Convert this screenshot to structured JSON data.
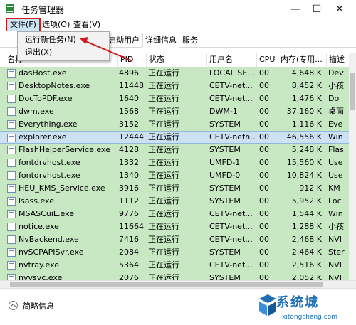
{
  "window": {
    "title": "任务管理器",
    "min": "—",
    "max": "☐",
    "close": "✕"
  },
  "menu": {
    "file": "文件(F)",
    "options": "选项(O)",
    "view": "查看(V)"
  },
  "file_menu": {
    "items": [
      "运行新任务(N)",
      "退出(X)"
    ]
  },
  "tabs": {
    "partial": "启动",
    "user": "用户",
    "details": "详细信息",
    "services": "服务"
  },
  "columns": {
    "name": "名称",
    "pid": "PID",
    "status": "状态",
    "user": "用户名",
    "cpu": "CPU",
    "memory": "内存(专用...",
    "desc": "描述"
  },
  "rows": [
    {
      "name": "dasHost.exe",
      "pid": "4896",
      "status": "正在运行",
      "user": "LOCAL SE...",
      "cpu": "00",
      "mem": "4,648 K",
      "desc": "Dev"
    },
    {
      "name": "DesktopNotes.exe",
      "pid": "11448",
      "status": "正在运行",
      "user": "CETV-net...",
      "cpu": "00",
      "mem": "8,452 K",
      "desc": "小孩"
    },
    {
      "name": "DocToPDF.exe",
      "pid": "1640",
      "status": "正在运行",
      "user": "CETV-net...",
      "cpu": "00",
      "mem": "1,476 K",
      "desc": "Do"
    },
    {
      "name": "dwm.exe",
      "pid": "1568",
      "status": "正在运行",
      "user": "DWM-1",
      "cpu": "00",
      "mem": "37,160 K",
      "desc": "桌面"
    },
    {
      "name": "Everything.exe",
      "pid": "3152",
      "status": "正在运行",
      "user": "SYSTEM",
      "cpu": "00",
      "mem": "1,116 K",
      "desc": "Eve"
    },
    {
      "name": "explorer.exe",
      "pid": "12444",
      "status": "正在运行",
      "user": "CETV-neth...",
      "cpu": "00",
      "mem": "46,556 K",
      "desc": "Win"
    },
    {
      "name": "FlashHelperService.exe",
      "pid": "4128",
      "status": "正在运行",
      "user": "SYSTEM",
      "cpu": "00",
      "mem": "5,248 K",
      "desc": "Flas"
    },
    {
      "name": "fontdrvhost.exe",
      "pid": "1332",
      "status": "正在运行",
      "user": "UMFD-1",
      "cpu": "00",
      "mem": "15,560 K",
      "desc": "Use"
    },
    {
      "name": "fontdrvhost.exe",
      "pid": "1340",
      "status": "正在运行",
      "user": "UMFD-0",
      "cpu": "00",
      "mem": "10,824 K",
      "desc": "Use"
    },
    {
      "name": "HEU_KMS_Service.exe",
      "pid": "3916",
      "status": "正在运行",
      "user": "SYSTEM",
      "cpu": "00",
      "mem": "912 K",
      "desc": "KM"
    },
    {
      "name": "lsass.exe",
      "pid": "1112",
      "status": "正在运行",
      "user": "SYSTEM",
      "cpu": "00",
      "mem": "5,952 K",
      "desc": "Loc"
    },
    {
      "name": "MSASCuiL.exe",
      "pid": "9776",
      "status": "正在运行",
      "user": "CETV-net...",
      "cpu": "00",
      "mem": "1,544 K",
      "desc": "Win"
    },
    {
      "name": "notice.exe",
      "pid": "11664",
      "status": "正在运行",
      "user": "CETV-net...",
      "cpu": "00",
      "mem": "1,288 K",
      "desc": "小孩"
    },
    {
      "name": "NvBackend.exe",
      "pid": "7416",
      "status": "正在运行",
      "user": "CETV-net...",
      "cpu": "00",
      "mem": "2,468 K",
      "desc": "NVI"
    },
    {
      "name": "nvSCPAPISvr.exe",
      "pid": "2084",
      "status": "正在运行",
      "user": "SYSTEM",
      "cpu": "00",
      "mem": "2,464 K",
      "desc": "Ster"
    },
    {
      "name": "nvtray.exe",
      "pid": "5364",
      "status": "正在运行",
      "user": "CETV-net...",
      "cpu": "00",
      "mem": "2,516 K",
      "desc": "NVI"
    },
    {
      "name": "nvvsvc.exe",
      "pid": "2076",
      "status": "正在运行",
      "user": "SYSTEM",
      "cpu": "00",
      "mem": "2,052 K",
      "desc": "NVI"
    }
  ],
  "footer": {
    "brief": "简略信息"
  },
  "watermark": {
    "text": "系统城",
    "url": "xitongcheng.com"
  },
  "colors": {
    "row_bg": "#c7e8c3",
    "selected_bg": "#cce1f2",
    "highlight_box": "#d21a1a",
    "watermark": "#1e6fb8"
  }
}
